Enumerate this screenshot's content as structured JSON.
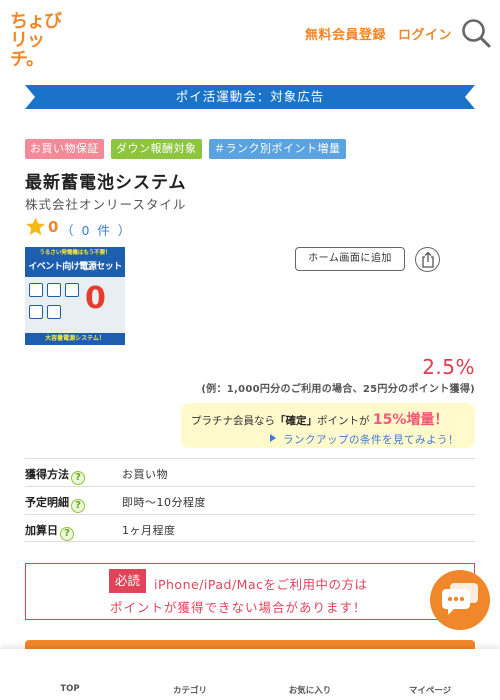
{
  "header": {
    "logo_line1": "ちょび",
    "logo_line2": "リッチ。",
    "register_label": "無料会員登録",
    "login_label": "ログイン"
  },
  "campaign": {
    "ribbon_text": "ポイ活運動会：対象広告",
    "ribbon_color": "#1a73c9"
  },
  "tags": [
    "お買い物保証",
    "ダウン報酬対象",
    "＃ランク別ポイント増量"
  ],
  "shop": {
    "title": "最新蓄電池システム",
    "company": "株式会社オンリースタイル",
    "rating_score": "0",
    "rating_count": "（ 0 件 ）"
  },
  "banner": {
    "sub": "うるさい発電機はもう不要！",
    "main": "イベント向け電源セット",
    "zero": "0",
    "foot": "大容量電源システム！"
  },
  "actions": {
    "home_screen_label": "ホーム画面に追加"
  },
  "points": {
    "rate": "2.5%",
    "example": "(例：1,000円分のご利用の場合、25円分のポイント獲得)",
    "platinum_prefix": "プラチナ会員なら",
    "platinum_bold": "「確定」",
    "platinum_mid": "ポイントが",
    "platinum_boost": "15%増量！",
    "rankup_link": "ランクアップの条件を見てみよう！"
  },
  "info_rows": [
    {
      "label": "獲得方法",
      "value": "お買い物"
    },
    {
      "label": "予定明細",
      "value": "即時～10分程度"
    },
    {
      "label": "加算日",
      "value": "1ヶ月程度"
    }
  ],
  "notice": {
    "badge": "必読",
    "line1": "iPhone/iPad/Macをご利用中の方は",
    "line2": "ポイントが獲得できない場合があります！"
  },
  "bottom_nav": {
    "top": "TOP",
    "category": "カテゴリ",
    "favorites": "お気に入り",
    "mypage": "マイページ"
  },
  "colors": {
    "brand_orange": "#f0872a",
    "accent_red": "#e0445a",
    "link_blue": "#3a7bd5"
  }
}
